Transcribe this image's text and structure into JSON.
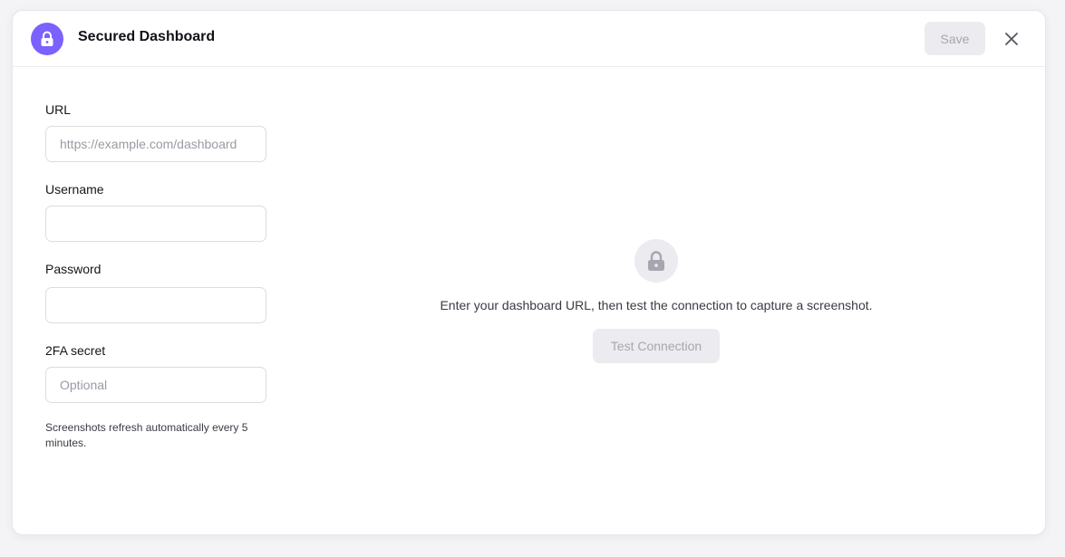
{
  "header": {
    "title": "Secured Dashboard",
    "icon": "lock-icon",
    "save_label": "Save",
    "close_icon": "close-icon"
  },
  "form": {
    "url": {
      "label": "URL",
      "value": "",
      "placeholder": "https://example.com/dashboard"
    },
    "username": {
      "label": "Username",
      "value": "",
      "placeholder": ""
    },
    "password": {
      "label": "Password",
      "value": "",
      "placeholder": ""
    },
    "twofa": {
      "label": "2FA secret",
      "value": "",
      "placeholder": "Optional"
    },
    "hint": "Screenshots refresh automatically every 5 minutes."
  },
  "empty_state": {
    "icon": "lock-icon",
    "message": "Enter your dashboard URL, then test the connection to capture a screenshot.",
    "test_label": "Test Connection"
  },
  "colors": {
    "accent": "#7b61ff",
    "disabled_bg": "#ececf0",
    "disabled_text": "#a6a6b0"
  }
}
